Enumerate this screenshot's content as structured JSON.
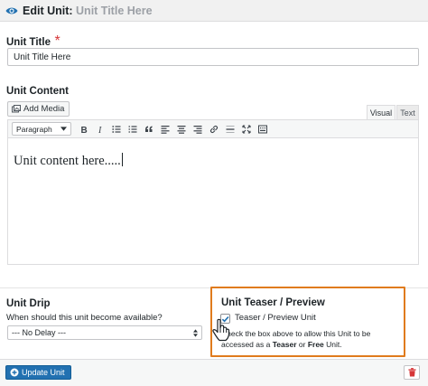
{
  "header": {
    "prefix": "Edit Unit:",
    "title_placeholder": "Unit Title Here"
  },
  "unit_title": {
    "label": "Unit Title",
    "required_mark": "*",
    "value": "Unit Title Here"
  },
  "unit_content": {
    "label": "Unit Content",
    "add_media": "Add Media",
    "tabs": [
      "Visual",
      "Text"
    ],
    "active_tab": "Visual",
    "format_select": "Paragraph",
    "toolbar_icons": [
      "bold-icon",
      "italic-icon",
      "bullet-list-icon",
      "numbered-list-icon",
      "blockquote-icon",
      "align-left-icon",
      "align-center-icon",
      "align-right-icon",
      "link-icon",
      "horizontal-line-icon",
      "fullscreen-icon",
      "toolbar-toggle-icon"
    ],
    "body": "Unit content here....."
  },
  "unit_drip": {
    "label": "Unit Drip",
    "question": "When should this unit become available?",
    "selected": "--- No Delay ---"
  },
  "teaser": {
    "label": "Unit Teaser / Preview",
    "checkbox_label": "Teaser / Preview Unit",
    "checked": true,
    "help_prefix": "Check the box above to allow this Unit to be accessed as a",
    "help_teaser": "Teaser",
    "help_or": "or",
    "help_free": "Free",
    "help_suffix": "Unit.",
    "highlight_color": "#e07b1d"
  },
  "footer": {
    "update_label": "Update Unit"
  },
  "colors": {
    "primary": "#2271b1",
    "danger": "#d63638"
  }
}
